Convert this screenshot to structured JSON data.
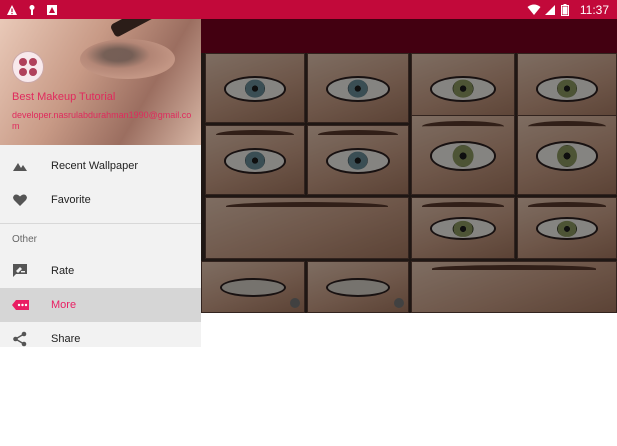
{
  "status_bar": {
    "time": "11:37",
    "left_icons": [
      "warning-icon",
      "key-icon",
      "photo-icon"
    ],
    "right_icons": [
      "wifi-icon",
      "signal-icon",
      "battery-icon"
    ],
    "color": "#c2093a"
  },
  "drawer": {
    "header": {
      "title": "Best Makeup Tutorial",
      "email": "developer.nasrulabdurahman1990@gmail.com",
      "accent": "#e02a5d"
    },
    "items": [
      {
        "label": "Recent Wallpaper",
        "icon": "landscape-icon"
      },
      {
        "label": "Favorite",
        "icon": "heart-icon"
      }
    ],
    "section_title": "Other",
    "other_items": [
      {
        "label": "Rate",
        "icon": "rate-review-icon"
      },
      {
        "label": "More",
        "icon": "more-tag-icon"
      },
      {
        "label": "Share",
        "icon": "share-icon"
      }
    ],
    "active_item": "More",
    "active_color": "#e91e63"
  },
  "app": {
    "toolbar_color": "#7a0020",
    "gallery_tiles": 11
  }
}
